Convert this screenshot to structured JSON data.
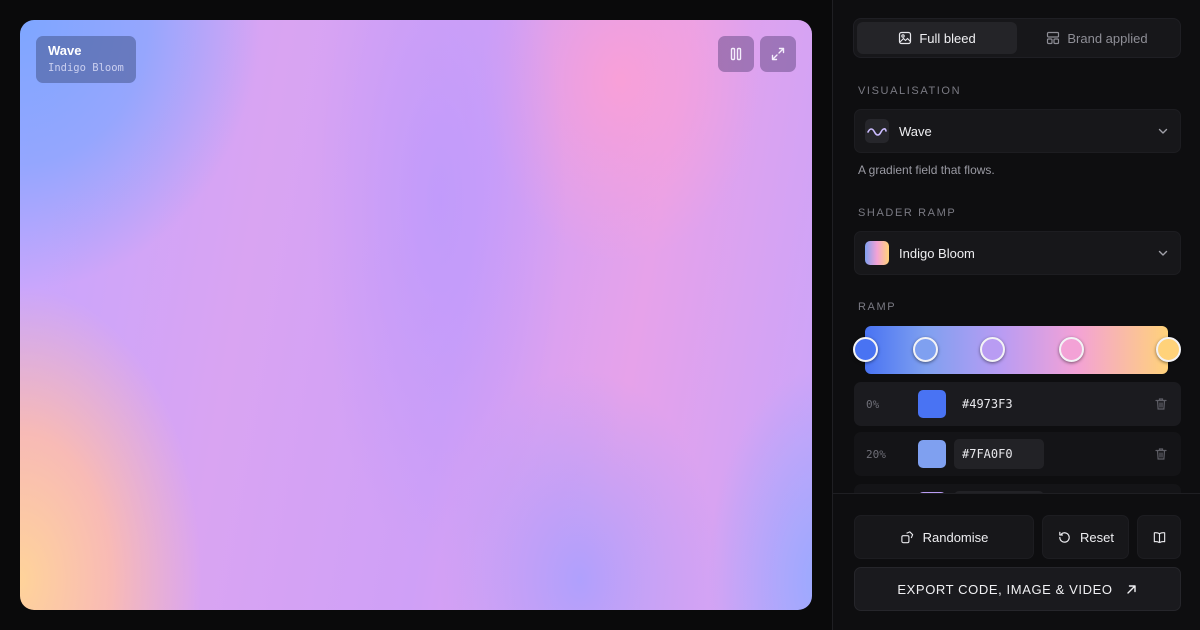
{
  "preview": {
    "title": "Wave",
    "subtitle": "Indigo Bloom",
    "pause_icon": "pause-icon",
    "fullscreen_icon": "expand-icon"
  },
  "mode_toggle": {
    "options": [
      {
        "label": "Full bleed",
        "icon": "image-icon",
        "active": true
      },
      {
        "label": "Brand applied",
        "icon": "layout-icon",
        "active": false
      }
    ]
  },
  "visualisation": {
    "heading": "VISUALISATION",
    "selected": "Wave",
    "icon": "wave-icon",
    "description": "A gradient field that flows."
  },
  "shader_ramp": {
    "heading": "SHADER RAMP",
    "selected": "Indigo Bloom",
    "swatch_colors": [
      "#7FA0F0",
      "#f3a2d6",
      "#ffd27a"
    ]
  },
  "ramp": {
    "heading": "RAMP",
    "stops": [
      {
        "position": 0.0,
        "color": "#4973F3"
      },
      {
        "position": 0.2,
        "color": "#7FA0F0"
      },
      {
        "position": 0.42,
        "color": "#b99cf3"
      },
      {
        "position": 0.68,
        "color": "#f3a2d6"
      },
      {
        "position": 1.0,
        "color": "#ffd27a"
      }
    ],
    "rows": [
      {
        "percent": "0%",
        "hex": "#4973F3",
        "color": "#4973F3",
        "selected": true
      },
      {
        "percent": "20%",
        "hex": "#7FA0F0",
        "color": "#7FA0F0",
        "selected": false
      }
    ]
  },
  "actions": {
    "randomise": "Randomise",
    "reset": "Reset",
    "docs_icon": "book-icon",
    "export": "EXPORT CODE, IMAGE & VIDEO"
  }
}
